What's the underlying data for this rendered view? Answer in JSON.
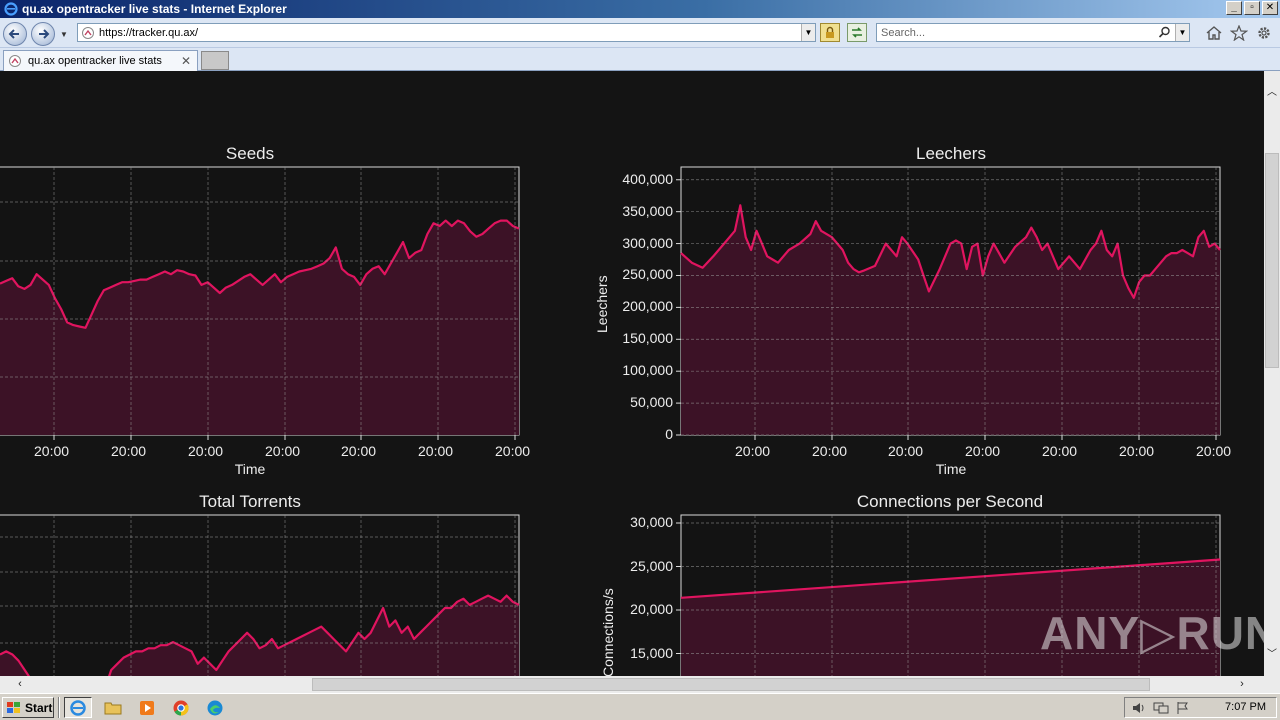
{
  "window": {
    "title": "qu.ax opentracker live stats - Internet Explorer",
    "controls": [
      "_",
      "▫",
      "✕"
    ]
  },
  "addressbar": {
    "url": "https://tracker.qu.ax/",
    "search_placeholder": "Search..."
  },
  "tabs": [
    {
      "label": "qu.ax opentracker live stats"
    }
  ],
  "colors": {
    "line": "#e0145f",
    "fill": "#3c1226",
    "plot_bg": "#131313",
    "grid": "#9a9a9a",
    "text": "#ededed"
  },
  "chart_data": [
    {
      "type": "area",
      "title": "Seeds",
      "xlabel": "Time",
      "ylabel": "",
      "x_ticks": [
        "20:00",
        "20:00",
        "20:00",
        "20:00",
        "20:00",
        "20:00",
        "20:00"
      ],
      "y_ticks": [],
      "grid": true,
      "series": [
        {
          "values": [
            0.565,
            0.575,
            0.585,
            0.555,
            0.545,
            0.56,
            0.6,
            0.58,
            0.56,
            0.51,
            0.47,
            0.42,
            0.41,
            0.405,
            0.4,
            0.45,
            0.5,
            0.54,
            0.55,
            0.56,
            0.57,
            0.57,
            0.575,
            0.58,
            0.58,
            0.59,
            0.6,
            0.61,
            0.6,
            0.615,
            0.61,
            0.6,
            0.595,
            0.56,
            0.57,
            0.55,
            0.53,
            0.55,
            0.56,
            0.575,
            0.59,
            0.6,
            0.58,
            0.56,
            0.58,
            0.6,
            0.57,
            0.59,
            0.6,
            0.61,
            0.615,
            0.62,
            0.63,
            0.64,
            0.66,
            0.7,
            0.62,
            0.6,
            0.59,
            0.56,
            0.6,
            0.62,
            0.63,
            0.6,
            0.64,
            0.68,
            0.72,
            0.66,
            0.68,
            0.69,
            0.75,
            0.79,
            0.78,
            0.8,
            0.78,
            0.8,
            0.79,
            0.76,
            0.74,
            0.75,
            0.77,
            0.79,
            0.8,
            0.8,
            0.78,
            0.77
          ]
        }
      ]
    },
    {
      "type": "area",
      "title": "Leechers",
      "xlabel": "Time",
      "ylabel": "Leechers",
      "ylim": [
        0,
        420000
      ],
      "y_ticks": [
        "400,000",
        "350,000",
        "300,000",
        "250,000",
        "200,000",
        "150,000",
        "100,000",
        "50,000",
        "0"
      ],
      "x_ticks": [
        "20:00",
        "20:00",
        "20:00",
        "20:00",
        "20:00",
        "20:00",
        "20:00"
      ],
      "grid": true,
      "series": [
        {
          "x_frac": [
            0.0,
            0.02,
            0.04,
            0.06,
            0.08,
            0.1,
            0.11,
            0.12,
            0.13,
            0.14,
            0.15,
            0.16,
            0.17,
            0.18,
            0.2,
            0.22,
            0.24,
            0.25,
            0.26,
            0.28,
            0.3,
            0.31,
            0.32,
            0.33,
            0.34,
            0.36,
            0.38,
            0.4,
            0.41,
            0.42,
            0.44,
            0.45,
            0.46,
            0.48,
            0.5,
            0.51,
            0.52,
            0.53,
            0.54,
            0.55,
            0.56,
            0.57,
            0.58,
            0.59,
            0.6,
            0.62,
            0.64,
            0.65,
            0.66,
            0.67,
            0.68,
            0.7,
            0.72,
            0.73,
            0.74,
            0.75,
            0.76,
            0.77,
            0.78,
            0.79,
            0.8,
            0.81,
            0.82,
            0.83,
            0.84,
            0.85,
            0.86,
            0.87,
            0.88,
            0.89,
            0.9,
            0.91,
            0.92,
            0.93,
            0.94,
            0.95,
            0.96,
            0.97,
            0.98,
            0.99,
            1.0
          ],
          "values": [
            285000,
            270000,
            262000,
            280000,
            300000,
            320000,
            360000,
            310000,
            290000,
            320000,
            300000,
            280000,
            275000,
            270000,
            290000,
            300000,
            315000,
            335000,
            320000,
            310000,
            290000,
            270000,
            260000,
            255000,
            258000,
            265000,
            300000,
            280000,
            310000,
            300000,
            275000,
            250000,
            225000,
            260000,
            300000,
            305000,
            300000,
            260000,
            295000,
            300000,
            250000,
            280000,
            300000,
            285000,
            270000,
            295000,
            310000,
            325000,
            310000,
            290000,
            300000,
            260000,
            280000,
            270000,
            260000,
            275000,
            290000,
            300000,
            320000,
            290000,
            280000,
            300000,
            250000,
            230000,
            215000,
            240000,
            250000,
            250000,
            260000,
            270000,
            280000,
            285000,
            285000,
            290000,
            285000,
            280000,
            310000,
            320000,
            295000,
            300000,
            290000
          ]
        }
      ]
    },
    {
      "type": "area",
      "title": "Total Torrents",
      "xlabel": "",
      "ylabel": "",
      "y_ticks": [],
      "x_ticks": [],
      "grid": true,
      "series": [
        {
          "values": [
            0.55,
            0.56,
            0.55,
            0.53,
            0.5,
            0.47,
            0.4,
            0.33,
            0.3,
            0.29,
            0.28,
            0.28,
            0.27,
            0.26,
            0.25,
            0.3,
            0.38,
            0.44,
            0.5,
            0.52,
            0.54,
            0.55,
            0.56,
            0.56,
            0.57,
            0.57,
            0.58,
            0.58,
            0.59,
            0.58,
            0.57,
            0.56,
            0.52,
            0.54,
            0.52,
            0.5,
            0.53,
            0.56,
            0.58,
            0.6,
            0.62,
            0.6,
            0.57,
            0.58,
            0.6,
            0.57,
            0.58,
            0.59,
            0.6,
            0.61,
            0.62,
            0.63,
            0.64,
            0.62,
            0.6,
            0.58,
            0.56,
            0.59,
            0.62,
            0.6,
            0.62,
            0.66,
            0.7,
            0.64,
            0.66,
            0.62,
            0.64,
            0.6,
            0.62,
            0.64,
            0.66,
            0.68,
            0.7,
            0.7,
            0.72,
            0.73,
            0.71,
            0.72,
            0.73,
            0.74,
            0.73,
            0.72,
            0.74,
            0.72,
            0.71
          ]
        }
      ]
    },
    {
      "type": "line",
      "title": "Connections per Second",
      "xlabel": "",
      "ylabel": "Connections/s",
      "ylim": [
        10000,
        31000
      ],
      "y_ticks": [
        "30,000",
        "25,000",
        "20,000",
        "15,000"
      ],
      "x_ticks": [],
      "grid": true,
      "series": [
        {
          "x_frac": [
            0.0,
            1.0
          ],
          "values": [
            21400,
            25800
          ]
        }
      ]
    }
  ],
  "taskbar": {
    "start_label": "Start",
    "clock": "7:07 PM"
  },
  "watermark": "ANY▷RUN"
}
